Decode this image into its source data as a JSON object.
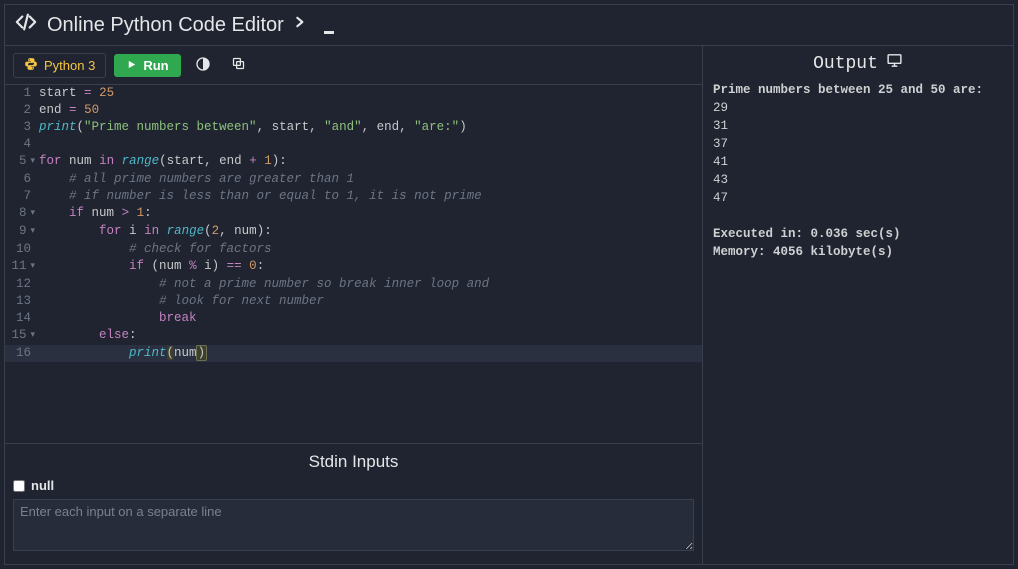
{
  "header": {
    "title": "Online Python Code Editor"
  },
  "toolbar": {
    "language_label": "Python 3",
    "run_label": "Run"
  },
  "editor": {
    "lines": [
      {
        "n": 1,
        "fold": false,
        "active": false,
        "tokens": [
          [
            "id",
            "start"
          ],
          [
            "pr",
            " "
          ],
          [
            "op",
            "="
          ],
          [
            "pr",
            " "
          ],
          [
            "nm",
            "25"
          ]
        ]
      },
      {
        "n": 2,
        "fold": false,
        "active": false,
        "tokens": [
          [
            "id",
            "end"
          ],
          [
            "pr",
            " "
          ],
          [
            "op",
            "="
          ],
          [
            "pr",
            " "
          ],
          [
            "nm",
            "50"
          ]
        ]
      },
      {
        "n": 3,
        "fold": false,
        "active": false,
        "tokens": [
          [
            "fn",
            "print"
          ],
          [
            "pr",
            "("
          ],
          [
            "st",
            "\"Prime numbers between\""
          ],
          [
            "pr",
            ", "
          ],
          [
            "id",
            "start"
          ],
          [
            "pr",
            ", "
          ],
          [
            "st",
            "\"and\""
          ],
          [
            "pr",
            ", "
          ],
          [
            "id",
            "end"
          ],
          [
            "pr",
            ", "
          ],
          [
            "st",
            "\"are:\""
          ],
          [
            "pr",
            ")"
          ]
        ]
      },
      {
        "n": 4,
        "fold": false,
        "active": false,
        "tokens": []
      },
      {
        "n": 5,
        "fold": true,
        "active": false,
        "tokens": [
          [
            "k",
            "for"
          ],
          [
            "pr",
            " "
          ],
          [
            "id",
            "num"
          ],
          [
            "pr",
            " "
          ],
          [
            "k",
            "in"
          ],
          [
            "pr",
            " "
          ],
          [
            "fn",
            "range"
          ],
          [
            "pr",
            "("
          ],
          [
            "id",
            "start"
          ],
          [
            "pr",
            ", "
          ],
          [
            "id",
            "end"
          ],
          [
            "pr",
            " "
          ],
          [
            "op",
            "+"
          ],
          [
            "pr",
            " "
          ],
          [
            "nm",
            "1"
          ],
          [
            "pr",
            "):"
          ]
        ]
      },
      {
        "n": 6,
        "fold": false,
        "active": false,
        "tokens": [
          [
            "pr",
            "    "
          ],
          [
            "cm",
            "# all prime numbers are greater than 1"
          ]
        ]
      },
      {
        "n": 7,
        "fold": false,
        "active": false,
        "tokens": [
          [
            "pr",
            "    "
          ],
          [
            "cm",
            "# if number is less than or equal to 1, it is not prime"
          ]
        ]
      },
      {
        "n": 8,
        "fold": true,
        "active": false,
        "tokens": [
          [
            "pr",
            "    "
          ],
          [
            "k",
            "if"
          ],
          [
            "pr",
            " "
          ],
          [
            "id",
            "num"
          ],
          [
            "pr",
            " "
          ],
          [
            "op",
            ">"
          ],
          [
            "pr",
            " "
          ],
          [
            "nm",
            "1"
          ],
          [
            "pr",
            ":"
          ]
        ]
      },
      {
        "n": 9,
        "fold": true,
        "active": false,
        "tokens": [
          [
            "pr",
            "        "
          ],
          [
            "k",
            "for"
          ],
          [
            "pr",
            " "
          ],
          [
            "id",
            "i"
          ],
          [
            "pr",
            " "
          ],
          [
            "k",
            "in"
          ],
          [
            "pr",
            " "
          ],
          [
            "fn",
            "range"
          ],
          [
            "pr",
            "("
          ],
          [
            "nm",
            "2"
          ],
          [
            "pr",
            ", "
          ],
          [
            "id",
            "num"
          ],
          [
            "pr",
            "):"
          ]
        ]
      },
      {
        "n": 10,
        "fold": false,
        "active": false,
        "tokens": [
          [
            "pr",
            "            "
          ],
          [
            "cm",
            "# check for factors"
          ]
        ]
      },
      {
        "n": 11,
        "fold": true,
        "active": false,
        "tokens": [
          [
            "pr",
            "            "
          ],
          [
            "k",
            "if"
          ],
          [
            "pr",
            " ("
          ],
          [
            "id",
            "num"
          ],
          [
            "pr",
            " "
          ],
          [
            "op",
            "%"
          ],
          [
            "pr",
            " "
          ],
          [
            "id",
            "i"
          ],
          [
            "pr",
            ") "
          ],
          [
            "op",
            "=="
          ],
          [
            "pr",
            " "
          ],
          [
            "nm",
            "0"
          ],
          [
            "pr",
            ":"
          ]
        ]
      },
      {
        "n": 12,
        "fold": false,
        "active": false,
        "tokens": [
          [
            "pr",
            "                "
          ],
          [
            "cm",
            "# not a prime number so break inner loop and"
          ]
        ]
      },
      {
        "n": 13,
        "fold": false,
        "active": false,
        "tokens": [
          [
            "pr",
            "                "
          ],
          [
            "cm",
            "# look for next number"
          ]
        ]
      },
      {
        "n": 14,
        "fold": false,
        "active": false,
        "tokens": [
          [
            "pr",
            "                "
          ],
          [
            "k",
            "break"
          ]
        ]
      },
      {
        "n": 15,
        "fold": true,
        "active": false,
        "tokens": [
          [
            "pr",
            "        "
          ],
          [
            "k",
            "else"
          ],
          [
            "pr",
            ":"
          ]
        ]
      },
      {
        "n": 16,
        "fold": false,
        "active": true,
        "tokens": [
          [
            "pr",
            "            "
          ],
          [
            "fn",
            "print"
          ],
          [
            "hl-paren-open",
            "("
          ],
          [
            "id",
            "num"
          ],
          [
            "hl-paren-close",
            ")"
          ]
        ]
      }
    ]
  },
  "stdin": {
    "title": "Stdin Inputs",
    "null_label": "null",
    "null_checked": false,
    "placeholder": "Enter each input on a separate line",
    "value": ""
  },
  "output": {
    "title": "Output",
    "header_line": "Prime numbers between 25 and 50 are:",
    "results": [
      "29",
      "31",
      "37",
      "41",
      "43",
      "47"
    ],
    "exec_line": "Executed in: 0.036 sec(s)",
    "mem_line": "Memory: 4056 kilobyte(s)"
  }
}
